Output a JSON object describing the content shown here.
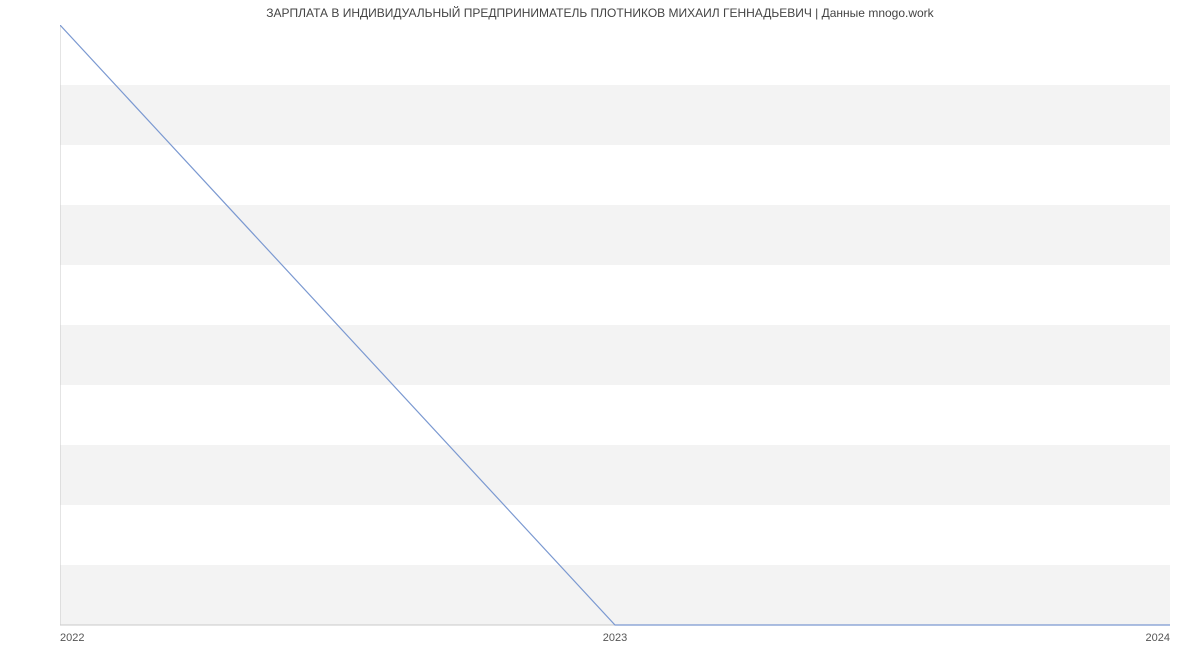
{
  "chart_data": {
    "type": "line",
    "title": "ЗАРПЛАТА В ИНДИВИДУАЛЬНЫЙ ПРЕДПРИНИМАТЕЛЬ ПЛОТНИКОВ МИХАИЛ ГЕННАДЬЕВИЧ | Данные mnogo.work",
    "xlabel": "",
    "ylabel": "",
    "x": [
      2022,
      2023,
      2024
    ],
    "y": [
      40000,
      35000,
      35000
    ],
    "xlim": [
      2022,
      2024
    ],
    "ylim": [
      35000,
      40000
    ],
    "yticks": [
      35000,
      35500,
      36000,
      36500,
      37000,
      37500,
      38000,
      38500,
      39000,
      39500,
      40000
    ],
    "xticks": [
      2022,
      2023,
      2024
    ],
    "grid": true,
    "bands": true,
    "line_color": "#7b99d1",
    "band_color": "#f3f3f3"
  }
}
